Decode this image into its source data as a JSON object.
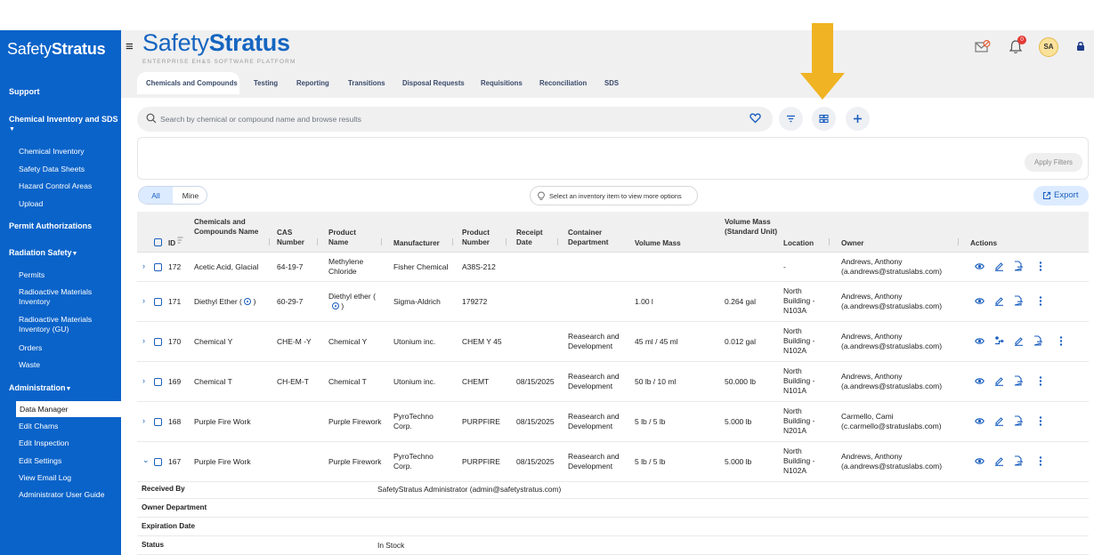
{
  "sidebar": {
    "logo_light": "Safety",
    "logo_bold": "Stratus",
    "sections": {
      "support": "Support",
      "chemical": "Chemical Inventory and SDS",
      "permit": "Permit Authorizations",
      "radiation": "Radiation Safety",
      "administration": "Administration"
    },
    "chemical_items": [
      "Chemical Inventory",
      "Safety Data Sheets",
      "Hazard Control Areas",
      "Upload"
    ],
    "radiation_items": [
      "Permits",
      "Radioactive Materials Inventory",
      "Radioactive Materials Inventory (GU)",
      "Orders",
      "Waste"
    ],
    "admin_items": [
      "Data Manager",
      "Edit Chams",
      "Edit Inspection",
      "Edit Settings",
      "View Email Log",
      "Administrator User Guide"
    ]
  },
  "header": {
    "brand_light": "Safety",
    "brand_bold": "Stratus",
    "tagline": "ENTERPRISE EH&S SOFTWARE PLATFORM",
    "notification_count": "0",
    "avatar_initials": "SA"
  },
  "tabs": [
    "Chemicals and Compounds",
    "Testing",
    "Reporting",
    "Transitions",
    "Disposal Requests",
    "Requisitions",
    "Reconciliation",
    "SDS"
  ],
  "search": {
    "placeholder": "Search by chemical or compound name and browse results"
  },
  "filters": {
    "apply_label": "Apply Filters"
  },
  "toggle": {
    "all": "All",
    "mine": "Mine"
  },
  "hint": "Select an inventory item to view more options",
  "export_label": "Export",
  "table": {
    "headers": {
      "id": "ID",
      "chem": "Chemicals and Compounds Name",
      "cas": "CAS Number",
      "product_name": "Product Name",
      "manufacturer": "Manufacturer",
      "product_number": "Product Number",
      "receipt": "Receipt Date",
      "container": "Container Department",
      "volume": "Volume Mass",
      "volume_std": "Volume Mass (Standard Unit)",
      "location": "Location",
      "owner": "Owner",
      "actions": "Actions"
    },
    "rows": [
      {
        "id": "172",
        "chem": "Acetic Acid, Glacial",
        "cas": "64-19-7",
        "product_name": "Methylene Chloride",
        "manufacturer": "Fisher Chemical",
        "product_number": "A38S-212",
        "receipt": "",
        "container": "",
        "volume": "",
        "volume_std": "",
        "location": "-",
        "owner_name": "Andrews, Anthony",
        "owner_email": "(a.andrews@stratuslabs.com)"
      },
      {
        "id": "171",
        "chem": "Diethyl Ether (",
        "cas": "60-29-7",
        "product_name": "Diethyl ether (",
        "manufacturer": "Sigma-Aldrich",
        "product_number": "179272",
        "receipt": "",
        "container": "",
        "volume": "1.00 l",
        "volume_std": "0.264 gal",
        "location": "North Building - N103A",
        "owner_name": "Andrews, Anthony",
        "owner_email": "(a.andrews@stratuslabs.com)"
      },
      {
        "id": "170",
        "chem": "Chemical Y",
        "cas": "CHE-M -Y",
        "product_name": "Chemical Y",
        "manufacturer": "Utonium inc.",
        "product_number": "CHEM Y 45",
        "receipt": "",
        "container": "Reasearch and Development",
        "volume": "45 ml / 45 ml",
        "volume_std": "0.012 gal",
        "location": "North Building - N102A",
        "owner_name": "Andrews, Anthony",
        "owner_email": "(a.andrews@stratuslabs.com)"
      },
      {
        "id": "169",
        "chem": "Chemical T",
        "cas": "CH-EM-T",
        "product_name": "Chemical T",
        "manufacturer": "Utonium inc.",
        "product_number": "CHEMT",
        "receipt": "08/15/2025",
        "container": "Reasearch and Development",
        "volume": "50 lb / 10 ml",
        "volume_std": "50.000 lb",
        "location": "North Building - N101A",
        "owner_name": "Andrews, Anthony",
        "owner_email": "(a.andrews@stratuslabs.com)"
      },
      {
        "id": "168",
        "chem": "Purple Fire Work",
        "cas": "",
        "product_name": "Purple Firework",
        "manufacturer": "PyroTechno Corp.",
        "product_number": "PURPFIRE",
        "receipt": "08/15/2025",
        "container": "Reasearch and Development",
        "volume": "5 lb / 5 lb",
        "volume_std": "5.000 lb",
        "location": "North Building - N201A",
        "owner_name": "Carmello, Cami",
        "owner_email": "(c.carmello@stratuslabs.com)"
      },
      {
        "id": "167",
        "chem": "Purple Fire Work",
        "cas": "",
        "product_name": "Purple Firework",
        "manufacturer": "PyroTechno Corp.",
        "product_number": "PURPFIRE",
        "receipt": "08/15/2025",
        "container": "Reasearch and Development",
        "volume": "5 lb / 5 lb",
        "volume_std": "5.000 lb",
        "location": "North Building - N102A",
        "owner_name": "Andrews, Anthony",
        "owner_email": "(a.andrews@stratuslabs.com)"
      }
    ],
    "row_171_suffix": ")",
    "details": [
      {
        "label": "Received By",
        "value": "SafetyStratus Administrator (admin@safetystratus.com)"
      },
      {
        "label": "Owner Department",
        "value": ""
      },
      {
        "label": "Expiration Date",
        "value": ""
      },
      {
        "label": "Status",
        "value": "In Stock"
      }
    ]
  },
  "colors": {
    "sidebar": "#0a63c9",
    "accent": "#1b5fbf",
    "arrow": "#f0b323"
  }
}
